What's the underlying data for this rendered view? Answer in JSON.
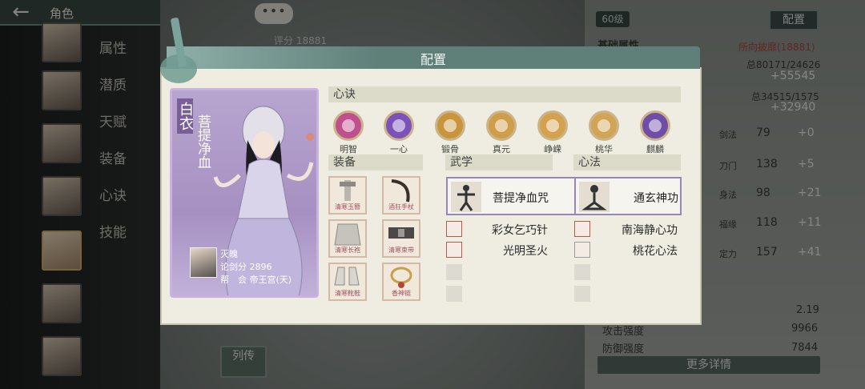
{
  "topbar": {
    "back_icon": "arrow-left-icon",
    "title": "角色"
  },
  "chat": {
    "label": "•••"
  },
  "score_strip": "评分 18881",
  "sidebar": {
    "tabs": [
      "属性",
      "潜质",
      "天赋",
      "装备",
      "心诀",
      "技能"
    ]
  },
  "right_panel": {
    "level": "60级",
    "config_button": "配置",
    "base_attr_label": "基础属性",
    "source_label": "所向披靡(18881)",
    "total1": "总80171/24626",
    "bonus1": "+55545",
    "total2": "总34515/1575",
    "bonus2": "+32940",
    "stats": [
      {
        "label": "剑法",
        "value": "79",
        "bonus": "+0"
      },
      {
        "label": "刀门",
        "value": "138",
        "bonus": "+5"
      },
      {
        "label": "身法",
        "value": "98",
        "bonus": "+21"
      },
      {
        "label": "福缘",
        "value": "118",
        "bonus": "+11"
      },
      {
        "label": "定力",
        "value": "157",
        "bonus": "+41"
      }
    ],
    "extra_value": "2.19",
    "attack_label": "攻击强度",
    "attack_value": "9966",
    "defense_label": "防御强度",
    "defense_value": "7844",
    "more_button": "更多详情",
    "legend_button": "列传"
  },
  "modal": {
    "title": "配置",
    "portrait": {
      "sub_title": "白衣",
      "title": "菩提净血",
      "player_name": "灭魄",
      "sword_score": "论剑分 2896",
      "guild": "帮　会 帝王宫(天)"
    },
    "techniques_header": "心诀",
    "techniques": [
      {
        "name": "明智",
        "color": "#c04f8e"
      },
      {
        "name": "一心",
        "color": "#7a52b8"
      },
      {
        "name": "锻骨",
        "color": "#c9953c"
      },
      {
        "name": "真元",
        "color": "#cf9e4a"
      },
      {
        "name": "峥嵘",
        "color": "#d4a24f"
      },
      {
        "name": "桃华",
        "color": "#d2a556"
      },
      {
        "name": "麒麟",
        "color": "#6e4ea6"
      }
    ],
    "equipment_header": "装备",
    "equipment": [
      {
        "label": "清寒玉簪"
      },
      {
        "label": "酒狂手杖"
      },
      {
        "label": "清寒长袍"
      },
      {
        "label": "清寒束带"
      },
      {
        "label": "清寒靴鞋"
      },
      {
        "label": "香神链"
      }
    ],
    "martial_header": "武学",
    "martial_main": "菩提净血咒",
    "martial_subs": [
      "彩女乞巧针",
      "光明圣火"
    ],
    "mind_header": "心法",
    "mind_main": "通玄神功",
    "mind_subs": [
      "南海静心功",
      "桃花心法"
    ]
  }
}
